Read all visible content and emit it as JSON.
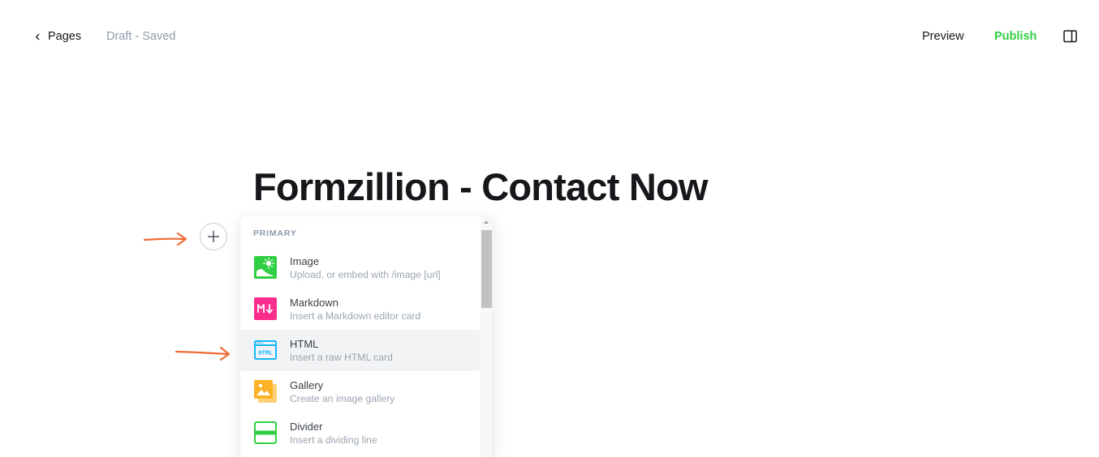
{
  "header": {
    "back_label": "Pages",
    "status": "Draft - Saved",
    "preview_label": "Preview",
    "publish_label": "Publish",
    "accent_color": "#30cf43"
  },
  "editor": {
    "title": "Formzillion - Contact Now"
  },
  "card_menu": {
    "section_label": "PRIMARY",
    "items": [
      {
        "label": "Image",
        "description": "Upload, or embed with /image [url]",
        "icon": "image-icon",
        "color": "#30cf43"
      },
      {
        "label": "Markdown",
        "description": "Insert a Markdown editor card",
        "icon": "markdown-icon",
        "color": "#fb2d8d"
      },
      {
        "label": "HTML",
        "description": "Insert a raw HTML card",
        "icon": "html-icon",
        "color": "#14b8ff"
      },
      {
        "label": "Gallery",
        "description": "Create an image gallery",
        "icon": "gallery-icon",
        "color": "#fcb325"
      },
      {
        "label": "Divider",
        "description": "Insert a dividing line",
        "icon": "divider-icon",
        "color": "#30cf43"
      }
    ],
    "highlighted_item": "HTML"
  },
  "annotations": {
    "arrow_color": "#ef6a35"
  }
}
